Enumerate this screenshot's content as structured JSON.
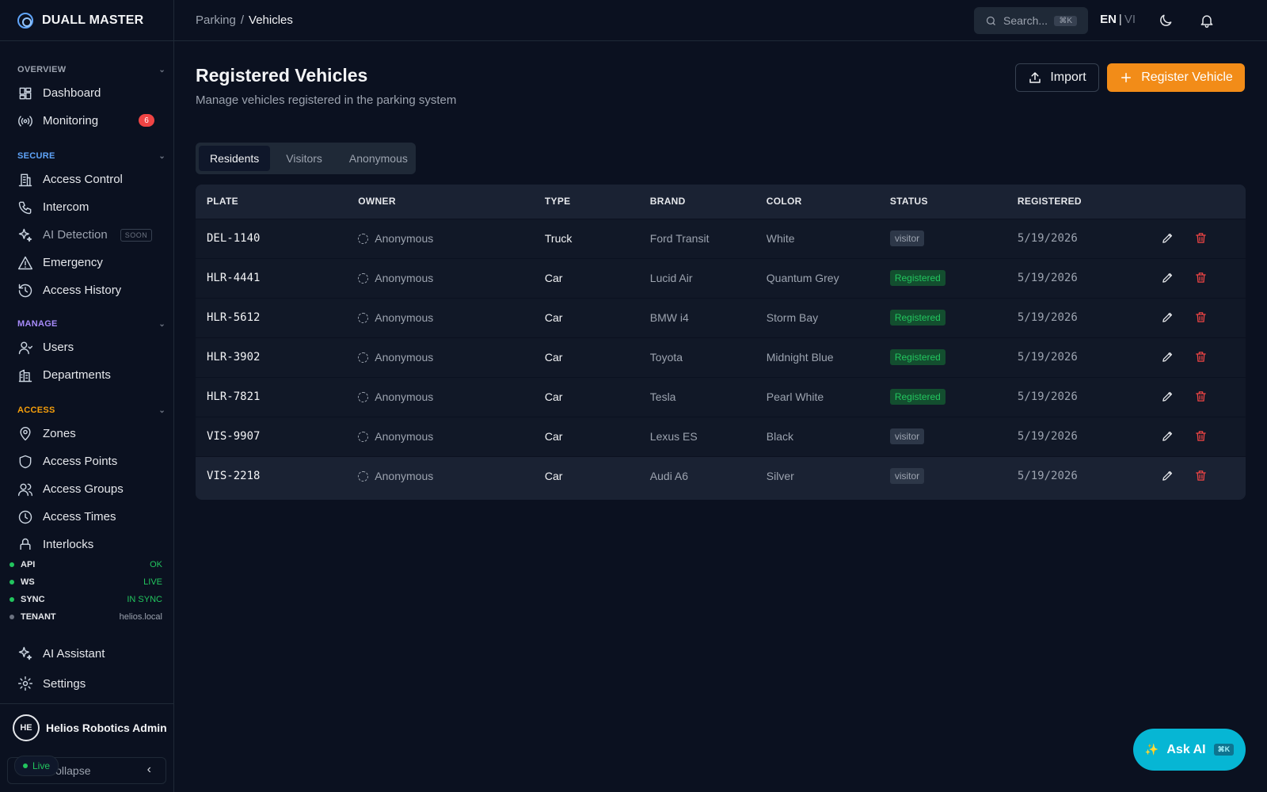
{
  "brand": {
    "name": "DUALL MASTER"
  },
  "sidebar": {
    "sections": [
      {
        "title": "OVERVIEW",
        "color": "#9ca3af",
        "items": [
          {
            "label": "Dashboard",
            "icon": "dashboard-icon"
          },
          {
            "label": "Monitoring",
            "icon": "broadcast-icon",
            "badge": "6"
          }
        ]
      },
      {
        "title": "SECURE",
        "color": "#60a5fa",
        "items": [
          {
            "label": "Access Control",
            "icon": "building-icon"
          },
          {
            "label": "Intercom",
            "icon": "phone-icon"
          },
          {
            "label": "AI Detection",
            "icon": "sparkles-icon",
            "tag": "SOON"
          },
          {
            "label": "Emergency",
            "icon": "alert-triangle-icon"
          },
          {
            "label": "Access History",
            "icon": "history-icon"
          }
        ]
      },
      {
        "title": "MANAGE",
        "color": "#a78bfa",
        "items": [
          {
            "label": "Users",
            "icon": "user-icon"
          },
          {
            "label": "Departments",
            "icon": "departments-icon"
          }
        ]
      },
      {
        "title": "ACCESS",
        "color": "#f59e0b",
        "items": [
          {
            "label": "Zones",
            "icon": "map-pin-icon"
          },
          {
            "label": "Access Points",
            "icon": "shield-icon"
          },
          {
            "label": "Access Groups",
            "icon": "users-icon"
          },
          {
            "label": "Access Times",
            "icon": "clock-icon"
          },
          {
            "label": "Interlocks",
            "icon": "lock-icon"
          }
        ]
      }
    ],
    "status": [
      {
        "key": "API",
        "value": "OK"
      },
      {
        "key": "WS",
        "value": "LIVE"
      },
      {
        "key": "SYNC",
        "value": "IN SYNC"
      },
      {
        "key": "TENANT",
        "value": "helios.local"
      }
    ],
    "bottom": [
      {
        "label": "AI Assistant",
        "icon": "sparkles-icon"
      },
      {
        "label": "Settings",
        "icon": "gear-icon"
      }
    ],
    "user": {
      "initials": "HE",
      "name": "Helios Robotics Admin"
    },
    "collapse_label": "Collapse",
    "live_label": "Live"
  },
  "header": {
    "breadcrumb": [
      "Parking",
      "Vehicles"
    ],
    "search_placeholder": "Search...",
    "search_kbd": "⌘K",
    "lang_active": "EN",
    "lang_other": "VI"
  },
  "page": {
    "title": "Registered Vehicles",
    "subtitle": "Manage vehicles registered in the parking system",
    "import_label": "Import",
    "register_label": "Register Vehicle",
    "tabs": [
      "Residents",
      "Visitors",
      "Anonymous"
    ],
    "active_tab": "Residents"
  },
  "table": {
    "columns": [
      "PLATE",
      "OWNER",
      "TYPE",
      "BRAND",
      "COLOR",
      "STATUS",
      "REGISTERED"
    ],
    "rows": [
      {
        "plate": "DEL-1140",
        "owner": "Anonymous",
        "type": "Truck",
        "brand": "Ford Transit",
        "color": "White",
        "status": "visitor",
        "registered": "5/19/2026"
      },
      {
        "plate": "HLR-4441",
        "owner": "Anonymous",
        "type": "Car",
        "brand": "Lucid Air",
        "color": "Quantum Grey",
        "status": "Registered",
        "registered": "5/19/2026"
      },
      {
        "plate": "HLR-5612",
        "owner": "Anonymous",
        "type": "Car",
        "brand": "BMW i4",
        "color": "Storm Bay",
        "status": "Registered",
        "registered": "5/19/2026"
      },
      {
        "plate": "HLR-3902",
        "owner": "Anonymous",
        "type": "Car",
        "brand": "Toyota",
        "color": "Midnight Blue",
        "status": "Registered",
        "registered": "5/19/2026"
      },
      {
        "plate": "HLR-7821",
        "owner": "Anonymous",
        "type": "Car",
        "brand": "Tesla",
        "color": "Pearl White",
        "status": "Registered",
        "registered": "5/19/2026"
      },
      {
        "plate": "VIS-9907",
        "owner": "Anonymous",
        "type": "Car",
        "brand": "Lexus ES",
        "color": "Black",
        "status": "visitor",
        "registered": "5/19/2026"
      },
      {
        "plate": "VIS-2218",
        "owner": "Anonymous",
        "type": "Car",
        "brand": "Audi A6",
        "color": "Silver",
        "status": "visitor",
        "registered": "5/19/2026"
      }
    ]
  },
  "ask_ai": {
    "label": "Ask AI",
    "kbd": "⌘K"
  },
  "colors": {
    "accent": "#f28c18",
    "ai": "#06b6d4",
    "ok": "#22c55e",
    "danger": "#ef4444"
  }
}
